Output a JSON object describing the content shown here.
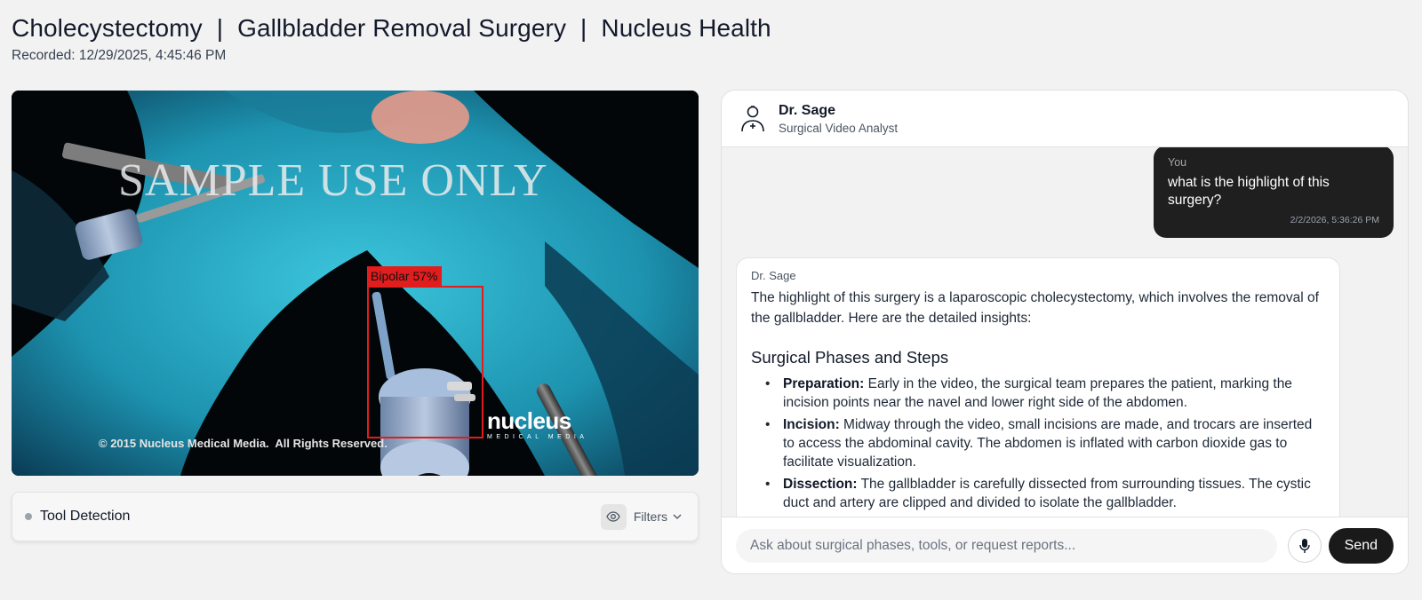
{
  "header": {
    "title_parts": [
      "Cholecystectomy",
      "Gallbladder Removal Surgery",
      "Nucleus Health"
    ],
    "separator": "|",
    "recorded": "Recorded: 12/29/2025, 4:45:46 PM"
  },
  "video": {
    "watermark": "SAMPLE USE ONLY",
    "copyright": "© 2015 Nucleus Medical Media.  All Rights Reserved.",
    "logo_main": "nucleus",
    "logo_sub": "MEDICAL MEDIA",
    "detection": {
      "label": "Bipolar 57%",
      "color": "#e11d1d"
    }
  },
  "tool_detection": {
    "label": "Tool Detection",
    "filters_label": "Filters",
    "eye_icon": "eye-icon",
    "chevron_icon": "chevron-down-icon"
  },
  "chat": {
    "agent": {
      "name": "Dr. Sage",
      "role": "Surgical Video Analyst",
      "icon": "doctor-icon"
    },
    "user_message": {
      "author": "You",
      "text": "what is the highlight of this surgery?",
      "time": "2/2/2026, 5:36:26 PM"
    },
    "bot_message": {
      "author": "Dr. Sage",
      "intro": "The highlight of this surgery is a laparoscopic cholecystectomy, which involves the removal of the gallbladder. Here are the detailed insights:",
      "heading": "Surgical Phases and Steps",
      "items": [
        {
          "term": "Preparation:",
          "text": " Early in the video, the surgical team prepares the patient, marking the incision points near the navel and lower right side of the abdomen."
        },
        {
          "term": "Incision:",
          "text": " Midway through the video, small incisions are made, and trocars are inserted to access the abdominal cavity. The abdomen is inflated with carbon dioxide gas to facilitate visualization."
        },
        {
          "term": "Dissection:",
          "text": " The gallbladder is carefully dissected from surrounding tissues. The cystic duct and artery are clipped and divided to isolate the gallbladder."
        }
      ]
    },
    "input_placeholder": "Ask about surgical phases, tools, or request reports...",
    "send_label": "Send",
    "mic_icon": "microphone-icon"
  },
  "colors": {
    "background": "#f2f2f2",
    "dark_bubble": "#1f1f1f",
    "send_button": "#1a1a1a",
    "detection_box": "#e11d1d",
    "tissue": "#2fb8d4"
  }
}
